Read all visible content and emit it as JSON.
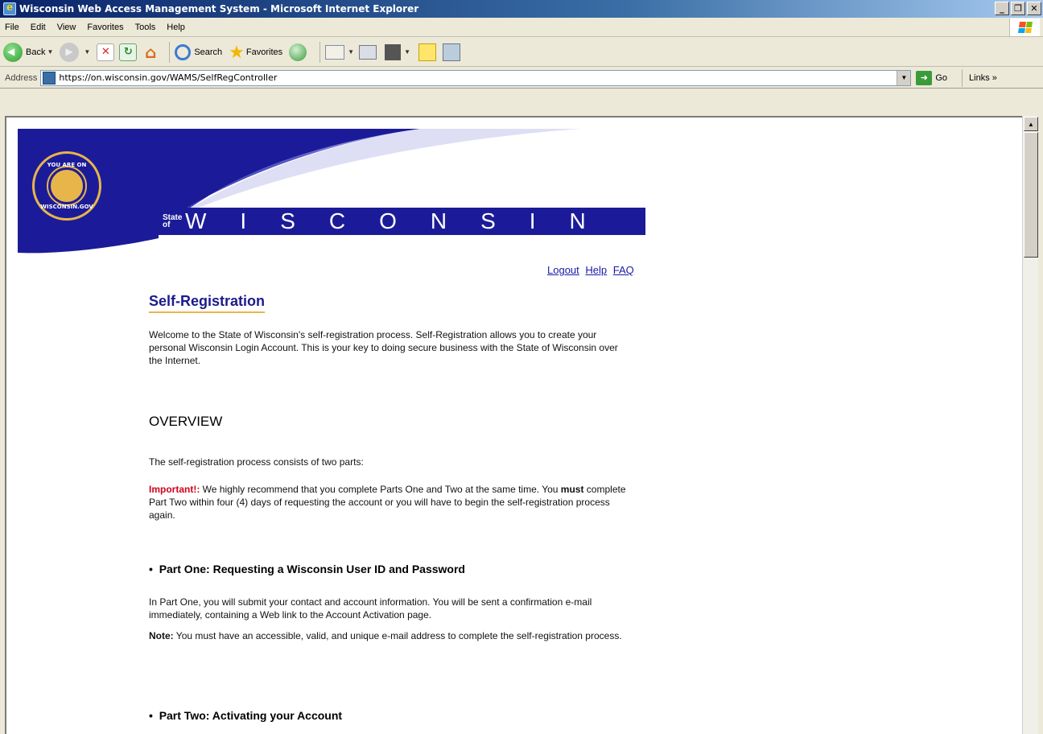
{
  "window": {
    "title": "Wisconsin Web Access Management System - Microsoft Internet Explorer",
    "controls": [
      "_",
      "❐",
      "✕"
    ]
  },
  "menu": [
    "File",
    "Edit",
    "View",
    "Favorites",
    "Tools",
    "Help"
  ],
  "toolbar": {
    "back": "Back",
    "search": "Search",
    "favorites": "Favorites"
  },
  "address": {
    "label": "Address",
    "url": "https://on.wisconsin.gov/WAMS/SelfRegController",
    "go": "Go",
    "links": "Links"
  },
  "banner": {
    "seal_top": "YOU ARE ON",
    "seal_bottom": "WISCONSIN.GOV",
    "state_of_1": "State",
    "state_of_2": "of",
    "wordmark": "WISCONSIN"
  },
  "nav": {
    "logout": "Logout",
    "help": "Help",
    "faq": "FAQ"
  },
  "page": {
    "title": "Self-Registration",
    "intro": "Welcome to the State of Wisconsin's self-registration process. Self-Registration allows you to create your personal Wisconsin Login Account. This is your key to doing secure business with the State of Wisconsin over the Internet.",
    "overview_heading": "OVERVIEW",
    "overview_text": "The self-registration process consists of two parts:",
    "important_label": "Important!:",
    "important_text_1": " We highly recommend that you complete Parts One and Two at the same time. You ",
    "important_must": "must",
    "important_text_2": " complete Part Two within four (4) days of requesting the account or you will have to begin the self-registration process again.",
    "part_one_title": "Part One: Requesting a Wisconsin User ID and Password",
    "part_one_text": "In Part One, you will submit your contact and account information. You will be sent a confirmation e-mail immediately, containing a Web link to the Account Activation page.",
    "note_label": "Note:",
    "note_text": " You must have an accessible, valid, and unique e-mail address to complete the self-registration process.",
    "part_two_title": "Part Two: Activating your Account"
  }
}
